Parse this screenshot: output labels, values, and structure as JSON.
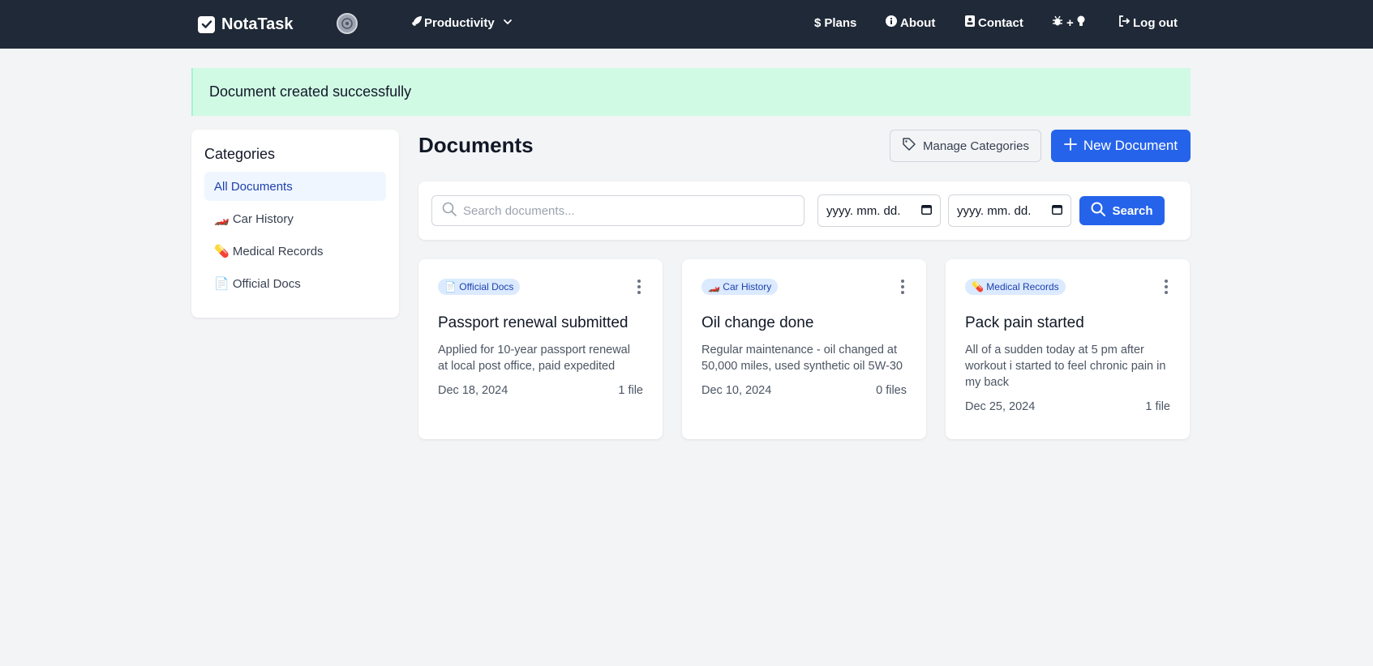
{
  "navbar": {
    "brand": "NotaTask",
    "dropdown_label": "Productivity",
    "links": {
      "plans": "Plans",
      "about": "About",
      "contact": "Contact",
      "logout": "Log out"
    },
    "bugs_ideas_label": "+"
  },
  "alert": {
    "message": "Document created successfully"
  },
  "sidebar": {
    "title": "Categories",
    "items": [
      {
        "label": "All Documents"
      },
      {
        "label": "🏎️ Car History"
      },
      {
        "label": "💊 Medical Records"
      },
      {
        "label": "📄 Official Docs"
      }
    ]
  },
  "main": {
    "title": "Documents",
    "manage_label": "Manage Categories",
    "new_label": "New Document"
  },
  "search": {
    "placeholder": "Search documents...",
    "date_from": "yyyy. mm. dd.",
    "date_to": "yyyy. mm. dd.",
    "button_label": "Search"
  },
  "documents": [
    {
      "category": "📄 Official Docs",
      "title": "Passport renewal submitted",
      "description": "Applied for 10-year passport renewal at local post office, paid expedited",
      "date": "Dec 18, 2024",
      "files": "1 file"
    },
    {
      "category": "🏎️ Car History",
      "title": "Oil change done",
      "description": "Regular maintenance - oil changed at 50,000 miles, used synthetic oil 5W-30",
      "date": "Dec 10, 2024",
      "files": "0 files"
    },
    {
      "category": "💊 Medical Records",
      "title": "Pack pain started",
      "description": "All of a sudden today at 5 pm after workout i started to feel chronic pain in my back",
      "date": "Dec 25, 2024",
      "files": "1 file"
    }
  ],
  "colors": {
    "navbar_bg": "#1f2937",
    "accent": "#2563eb",
    "alert_bg": "#d1fae5",
    "page_bg": "#f3f4f6"
  }
}
